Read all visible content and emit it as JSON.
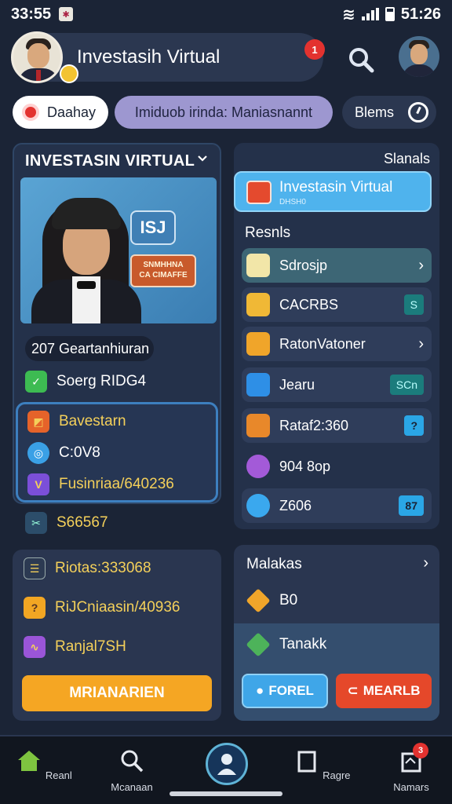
{
  "status_bar": {
    "time_left": "33:55",
    "time_right": "51:26"
  },
  "header": {
    "title": "Investasih Virtual",
    "notification_count": "1"
  },
  "pills": [
    {
      "label": "Daahay"
    },
    {
      "label": "Imiduob irinda: Maniasnannt"
    },
    {
      "label": "Blems"
    }
  ],
  "left_card": {
    "title": "INVESTASIN VIRTUAL",
    "bubble_top": "ISJ",
    "bubble_bottom_line1": "SNMHHNA",
    "bubble_bottom_line2": "CA CIMAFFE",
    "category_badge": "207 Geartanhiuran",
    "stat_row": "Soerg RIDG4",
    "sub_items": [
      {
        "label": "Bavestarn"
      },
      {
        "label": "C:0V8"
      },
      {
        "label": "Fusinriaa/640236"
      }
    ],
    "extra_row": "S66567"
  },
  "left_bottom_card": {
    "items": [
      {
        "label": "Riotas:333068"
      },
      {
        "label": "RiJCniaasin/40936"
      },
      {
        "label": "Ranjal7SH"
      }
    ],
    "button": "MRIANARIEN"
  },
  "right_card": {
    "header": "Slanals",
    "active_title": "Investasin Virtual",
    "active_sub": "DHSH0",
    "section": "Resnls",
    "items": [
      {
        "label": "Sdrosjp",
        "tag": ""
      },
      {
        "label": "CACRBS",
        "tag": "S"
      },
      {
        "label": "RatonVatoner",
        "tag": ""
      },
      {
        "label": "Jearu",
        "tag": "SCn"
      },
      {
        "label": "Rataf2:360",
        "tag": "?"
      },
      {
        "label": "904 8op",
        "tag": ""
      },
      {
        "label": "Z606",
        "tag": "87"
      }
    ]
  },
  "right_bottom_card": {
    "title": "Malakas",
    "item_1": "B0",
    "item_2": "Tanakk",
    "button_blue": "FOREL",
    "button_red": "MEARLB"
  },
  "bottom_nav": {
    "items": [
      {
        "label": "Reanl"
      },
      {
        "label": "Mcanaan"
      },
      {
        "label": "Ragre"
      },
      {
        "label": "Namars"
      }
    ],
    "badge": "3"
  },
  "colors": {
    "background": "#1b2436",
    "card": "#24314a",
    "accent_blue": "#4fb3ed",
    "accent_orange": "#f5a623",
    "accent_red": "#e5482a"
  }
}
